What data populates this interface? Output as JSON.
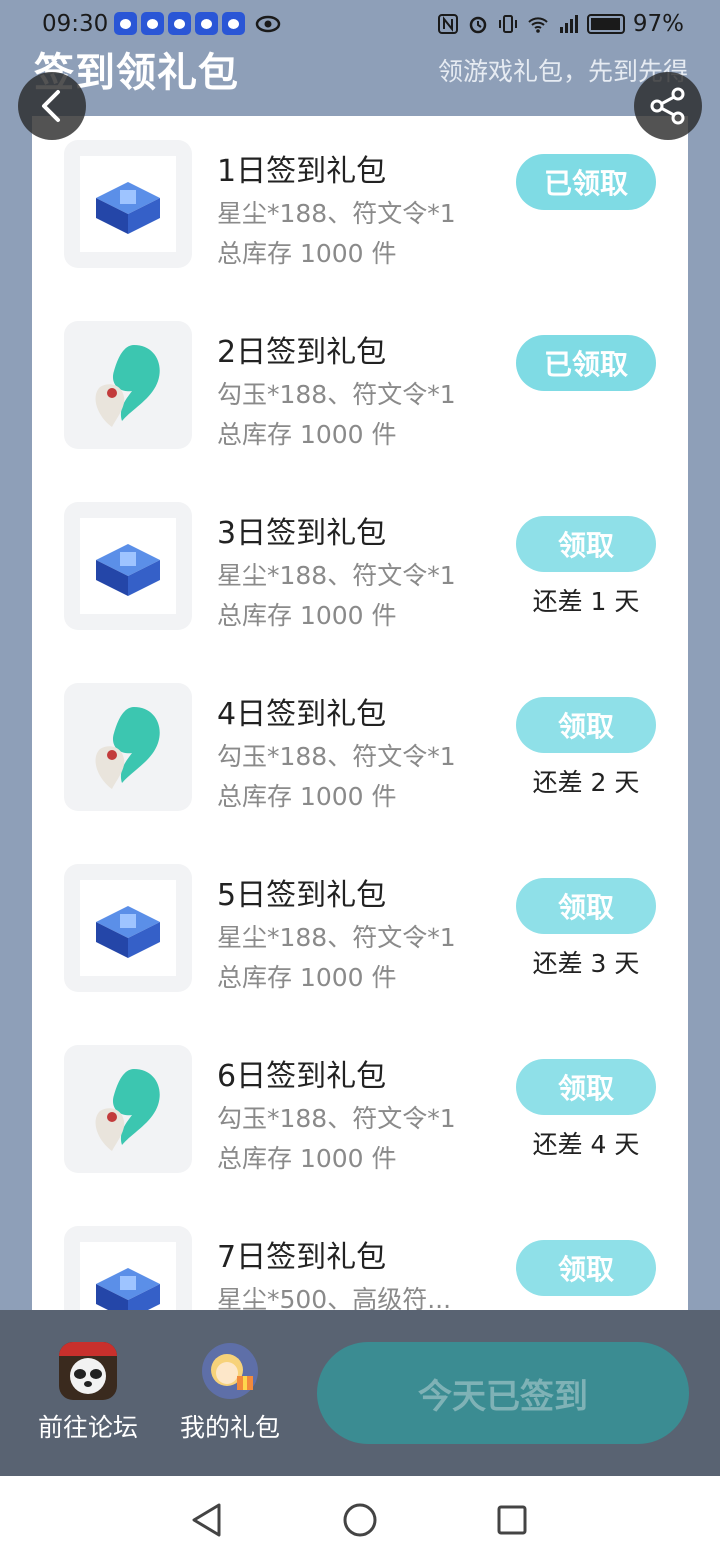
{
  "status": {
    "time": "09:30",
    "battery": "97%"
  },
  "header": {
    "title": "签到领礼包",
    "subtitle": "领游戏礼包，先到先得"
  },
  "items": [
    {
      "title": "1日签到礼包",
      "desc": "星尘*188、符文令*1",
      "stock": "总库存 1000 件",
      "button": "已领取",
      "remain": "",
      "icon": "blue-chest-icon"
    },
    {
      "title": "2日签到礼包",
      "desc": "勾玉*188、符文令*1",
      "stock": "总库存 1000 件",
      "button": "已领取",
      "remain": "",
      "icon": "jade-magatama-icon"
    },
    {
      "title": "3日签到礼包",
      "desc": "星尘*188、符文令*1",
      "stock": "总库存 1000 件",
      "button": "领取",
      "remain": "还差 1 天",
      "icon": "blue-chest-icon"
    },
    {
      "title": "4日签到礼包",
      "desc": "勾玉*188、符文令*1",
      "stock": "总库存 1000 件",
      "button": "领取",
      "remain": "还差 2 天",
      "icon": "jade-magatama-icon"
    },
    {
      "title": "5日签到礼包",
      "desc": "星尘*188、符文令*1",
      "stock": "总库存 1000 件",
      "button": "领取",
      "remain": "还差 3 天",
      "icon": "blue-chest-icon"
    },
    {
      "title": "6日签到礼包",
      "desc": "勾玉*188、符文令*1",
      "stock": "总库存 1000 件",
      "button": "领取",
      "remain": "还差 4 天",
      "icon": "jade-magatama-icon"
    },
    {
      "title": "7日签到礼包",
      "desc": "星尘*500、高级符...",
      "stock": "",
      "button": "领取",
      "remain": "",
      "icon": "blue-chest-icon"
    }
  ],
  "bottom": {
    "forum_label": "前往论坛",
    "gift_label": "我的礼包",
    "signed_label": "今天已签到"
  },
  "colors": {
    "background": "#8e9fb8",
    "button": "#8fe0e8",
    "bottom_bar": "#596372",
    "signed_button": "#3b8c92"
  }
}
